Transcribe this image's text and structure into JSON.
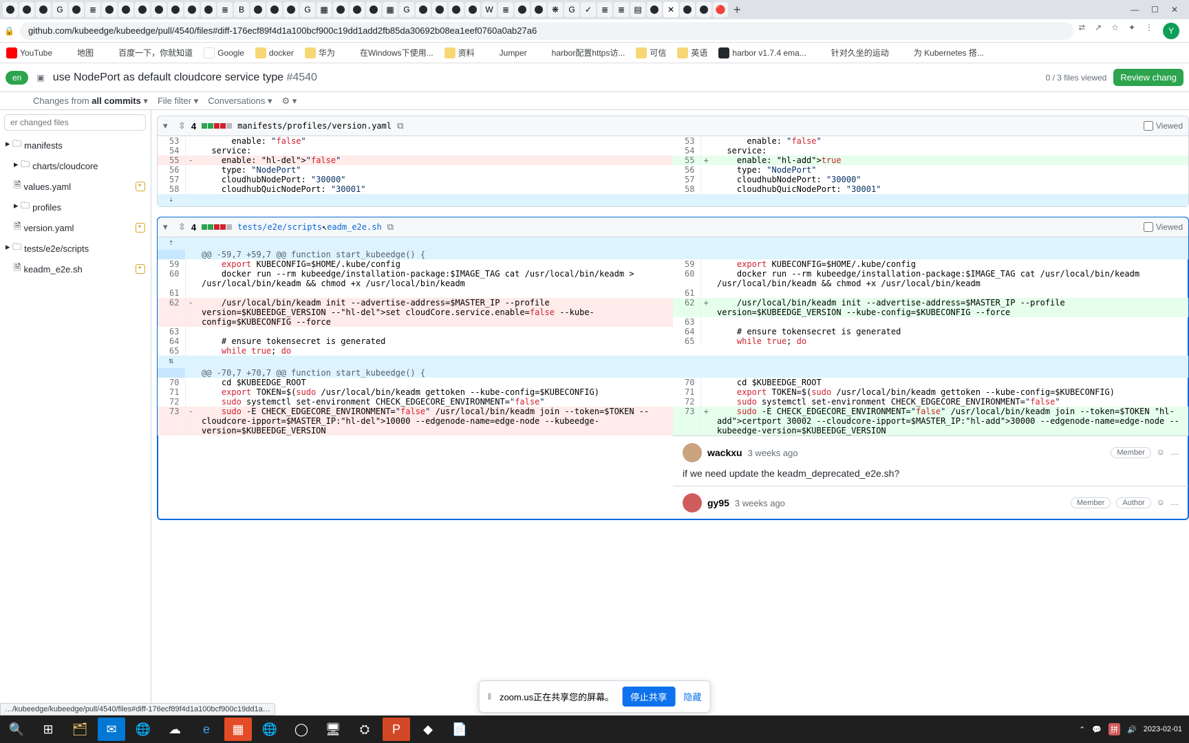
{
  "browser": {
    "url": "github.com/kubeedge/kubeedge/pull/4540/files#diff-176ecf89f4d1a100bcf900c19dd1add2fb85da30692b08ea1eef0760a0ab27a6",
    "window_min": "—",
    "window_max": "☐",
    "window_close": "✕",
    "new_tab": "+",
    "avatar_letter": "Y",
    "status_link": "…/kubeedge/kubeedge/pull/4540/files#diff-176ecf89f4d1a100bcf900c19dd1a…"
  },
  "bookmarks": [
    {
      "label": "YouTube"
    },
    {
      "label": "地图"
    },
    {
      "label": "百度一下，你就知道"
    },
    {
      "label": "Google"
    },
    {
      "label": "docker"
    },
    {
      "label": "华为"
    },
    {
      "label": "在Windows下使用..."
    },
    {
      "label": "资料"
    },
    {
      "label": "Jumper"
    },
    {
      "label": "harbor配置https访..."
    },
    {
      "label": "可信"
    },
    {
      "label": "英语"
    },
    {
      "label": "harbor v1.7.4 ema..."
    },
    {
      "label": "针对久坐的运动"
    },
    {
      "label": "为 Kubernetes 搭..."
    }
  ],
  "pr": {
    "state": "en",
    "title": "use NodePort as default cloudcore service type",
    "number": "#4540",
    "files_viewed": "0 / 3 files viewed",
    "review_btn": "Review chang",
    "toolbar": {
      "changes_from": "Changes from",
      "all_commits": "all commits",
      "file_filter": "File filter",
      "conversations": "Conversations",
      "gear": "⚙"
    }
  },
  "sidebar": {
    "filter_placeholder": "er changed files",
    "tree": [
      {
        "label": "manifests",
        "type": "folder"
      },
      {
        "label": "charts/cloudcore",
        "type": "folder",
        "indent": 1
      },
      {
        "label": "values.yaml",
        "type": "file",
        "indent": 2,
        "badge": true
      },
      {
        "label": "profiles",
        "type": "folder",
        "indent": 1
      },
      {
        "label": "version.yaml",
        "type": "file",
        "indent": 2,
        "badge": true,
        "selected": false
      },
      {
        "label": "tests/e2e/scripts",
        "type": "folder"
      },
      {
        "label": "keadm_e2e.sh",
        "type": "file",
        "indent": 1,
        "badge": true
      }
    ]
  },
  "file1": {
    "count": "4",
    "path": "manifests/profiles/version.yaml",
    "viewed": "Viewed",
    "left": {
      "lines": [
        {
          "n": "53",
          "c": "      enable: \"false\""
        },
        {
          "n": "54",
          "c": "  service:"
        },
        {
          "n": "55",
          "c": "    enable: \"false\"",
          "del": true,
          "hl": "\"false\""
        },
        {
          "n": "56",
          "c": "    type: \"NodePort\""
        },
        {
          "n": "57",
          "c": "    cloudhubNodePort: \"30000\""
        },
        {
          "n": "58",
          "c": "    cloudhubQuicNodePort: \"30001\""
        }
      ]
    },
    "right": {
      "lines": [
        {
          "n": "53",
          "c": "      enable: \"false\""
        },
        {
          "n": "54",
          "c": "  service:"
        },
        {
          "n": "55",
          "c": "    enable: true",
          "add": true,
          "hl": "true"
        },
        {
          "n": "56",
          "c": "    type: \"NodePort\""
        },
        {
          "n": "57",
          "c": "    cloudhubNodePort: \"30000\""
        },
        {
          "n": "58",
          "c": "    cloudhubQuicNodePort: \"30001\""
        }
      ]
    }
  },
  "file2": {
    "count": "4",
    "path_pre": "tests/e2e/scripts",
    "path_post": "eadm_e2e.sh",
    "viewed": "Viewed",
    "hunk1": "@@ -59,7 +59,7 @@ function start_kubeedge() {",
    "hunk2": "@@ -70,7 +70,7 @@ function start_kubeedge() {",
    "left1": [
      {
        "n": "59",
        "c": "    export KUBECONFIG=$HOME/.kube/config"
      },
      {
        "n": "60",
        "c": "    docker run --rm kubeedge/installation-package:$IMAGE_TAG cat /usr/local/bin/keadm > /usr/local/bin/keadm && chmod +x /usr/local/bin/keadm"
      },
      {
        "n": "61",
        "c": ""
      },
      {
        "n": "62",
        "c": "    /usr/local/bin/keadm init --advertise-address=$MASTER_IP --profile version=$KUBEEDGE_VERSION --set cloudCore.service.enable=false --kube-config=$KUBECONFIG --force",
        "del": true,
        "hl": "set cloudCore.service.enable=false --"
      },
      {
        "n": "63",
        "c": ""
      },
      {
        "n": "64",
        "c": "    # ensure tokensecret is generated"
      },
      {
        "n": "65",
        "c": "    while true; do"
      }
    ],
    "right1": [
      {
        "n": "59",
        "c": "    export KUBECONFIG=$HOME/.kube/config"
      },
      {
        "n": "60",
        "c": "    docker run --rm kubeedge/installation-package:$IMAGE_TAG cat /usr/local/bin/keadm /usr/local/bin/keadm && chmod +x /usr/local/bin/keadm"
      },
      {
        "n": "61",
        "c": ""
      },
      {
        "n": "62",
        "c": "    /usr/local/bin/keadm init --advertise-address=$MASTER_IP --profile version=$KUBEEDGE_VERSION --kube-config=$KUBECONFIG --force",
        "add": true
      },
      {
        "n": "63",
        "c": ""
      },
      {
        "n": "64",
        "c": "    # ensure tokensecret is generated"
      },
      {
        "n": "65",
        "c": "    while true; do"
      }
    ],
    "left2": [
      {
        "n": "70",
        "c": "    cd $KUBEEDGE_ROOT"
      },
      {
        "n": "71",
        "c": "    export TOKEN=$(sudo /usr/local/bin/keadm gettoken --kube-config=$KUBECONFIG)"
      },
      {
        "n": "72",
        "c": "    sudo systemctl set-environment CHECK_EDGECORE_ENVIRONMENT=\"false\""
      },
      {
        "n": "73",
        "c": "    sudo -E CHECK_EDGECORE_ENVIRONMENT=\"false\" /usr/local/bin/keadm join --token=$TOKEN --cloudcore-ipport=$MASTER_IP:10000 --edgenode-name=edge-node --kubeedge-version=$KUBEEDGE_VERSION",
        "del": true,
        "hl": "10000"
      }
    ],
    "right2": [
      {
        "n": "70",
        "c": "    cd $KUBEEDGE_ROOT"
      },
      {
        "n": "71",
        "c": "    export TOKEN=$(sudo /usr/local/bin/keadm gettoken --kube-config=$KUBECONFIG)"
      },
      {
        "n": "72",
        "c": "    sudo systemctl set-environment CHECK_EDGECORE_ENVIRONMENT=\"false\""
      },
      {
        "n": "73",
        "c": "    sudo -E CHECK_EDGECORE_ENVIRONMENT=\"false\" /usr/local/bin/keadm join --token=$TOKEN certport 30002 --cloudcore-ipport=$MASTER_IP:30000 --edgenode-name=edge-node --kubeedge-version=$KUBEEDGE_VERSION",
        "add": true,
        "hl": "certport 30002 --",
        "hl2": "30000"
      }
    ]
  },
  "comments": [
    {
      "user": "wackxu",
      "time": "3 weeks ago",
      "badges": [
        "Member"
      ],
      "body": "if we need update the keadm_deprecated_e2e.sh?",
      "avatar": "#c9a47f"
    },
    {
      "user": "gy95",
      "time": "3 weeks ago",
      "badges": [
        "Member",
        "Author"
      ],
      "avatar": "#d15c5c"
    }
  ],
  "share": {
    "text": "zoom.us正在共享您的屏幕。",
    "stop": "停止共享",
    "hide": "隐藏"
  },
  "taskbar": {
    "date": "2023-02-01"
  }
}
